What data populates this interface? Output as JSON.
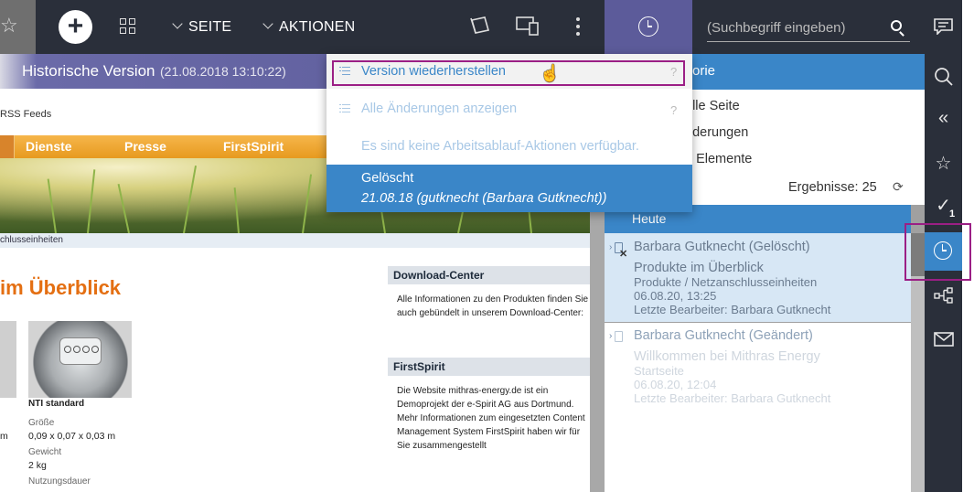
{
  "topbar": {
    "seite_label": "SEITE",
    "aktionen_label": "AKTIONEN",
    "search_placeholder": "(Suchbegriff eingeben)"
  },
  "history_version": {
    "title": "Historische Version",
    "date": "(21.08.2018 13:10:22)"
  },
  "preview": {
    "rss": "RSS Feeds",
    "nav": [
      "Dienste",
      "Presse",
      "FirstSpirit"
    ],
    "breadcrumb": "chlusseinheiten",
    "heading": "im Überblick",
    "product_name": "NTI standard",
    "spec_size_label": "Größe",
    "spec_size_value": "0,09 x 0,07 x 0,03 m",
    "spec_weight_label": "Gewicht",
    "spec_weight_value": "2 kg",
    "spec_duration_label": "Nutzungsdauer",
    "left_fragment": "m",
    "download_title": "Download-Center",
    "download_text": "Alle Informationen zu den Produkten finden Sie auch gebündelt in unserem Download-Center:",
    "firstspirit_title": "FirstSpirit",
    "firstspirit_text": "Die Website mithras-energy.de ist ein Demoprojekt der e-Spirit AG aus Dortmund. Mehr Informationen zum eingesetzten Content Management System FirstSpirit haben wir für Sie zusammengestellt"
  },
  "dropdown": {
    "restore_label": "Version wiederherstellen",
    "changes_label": "Alle Änderungen anzeigen",
    "help": "?",
    "info": "Es sind keine Arbeitsablauf-Aktionen verfügbar.",
    "deleted_title": "Gelöscht",
    "deleted_sub": "21.08.18 (gutknecht (Barbara Gutknecht))"
  },
  "history_panel": {
    "title": "orie",
    "filters": [
      "elle Seite",
      "nderungen",
      "e Elemente"
    ],
    "results": "Ergebnisse: 25",
    "group": "Heute",
    "entries": [
      {
        "user": "Barbara Gutknecht (Gelöscht)",
        "page": "Produkte im Überblick",
        "path": "Produkte / Netzanschlusseinheiten",
        "time": "06.08.20, 13:25",
        "editor": "Letzte Bearbeiter: Barbara Gutknecht"
      },
      {
        "user": "Barbara Gutknecht (Geändert)",
        "page": "Willkommen bei Mithras Energy",
        "path": "Startseite",
        "time": "06.08.20, 12:04",
        "editor": "Letzte Bearbeiter: Barbara Gutknecht"
      }
    ]
  },
  "rightbar": {
    "badge": "1"
  },
  "colors": {
    "accent": "#3a86c8",
    "toolbar": "#2a2f3a",
    "history_tab": "#5c5b9a",
    "highlight_outline": "#9b1f85"
  }
}
